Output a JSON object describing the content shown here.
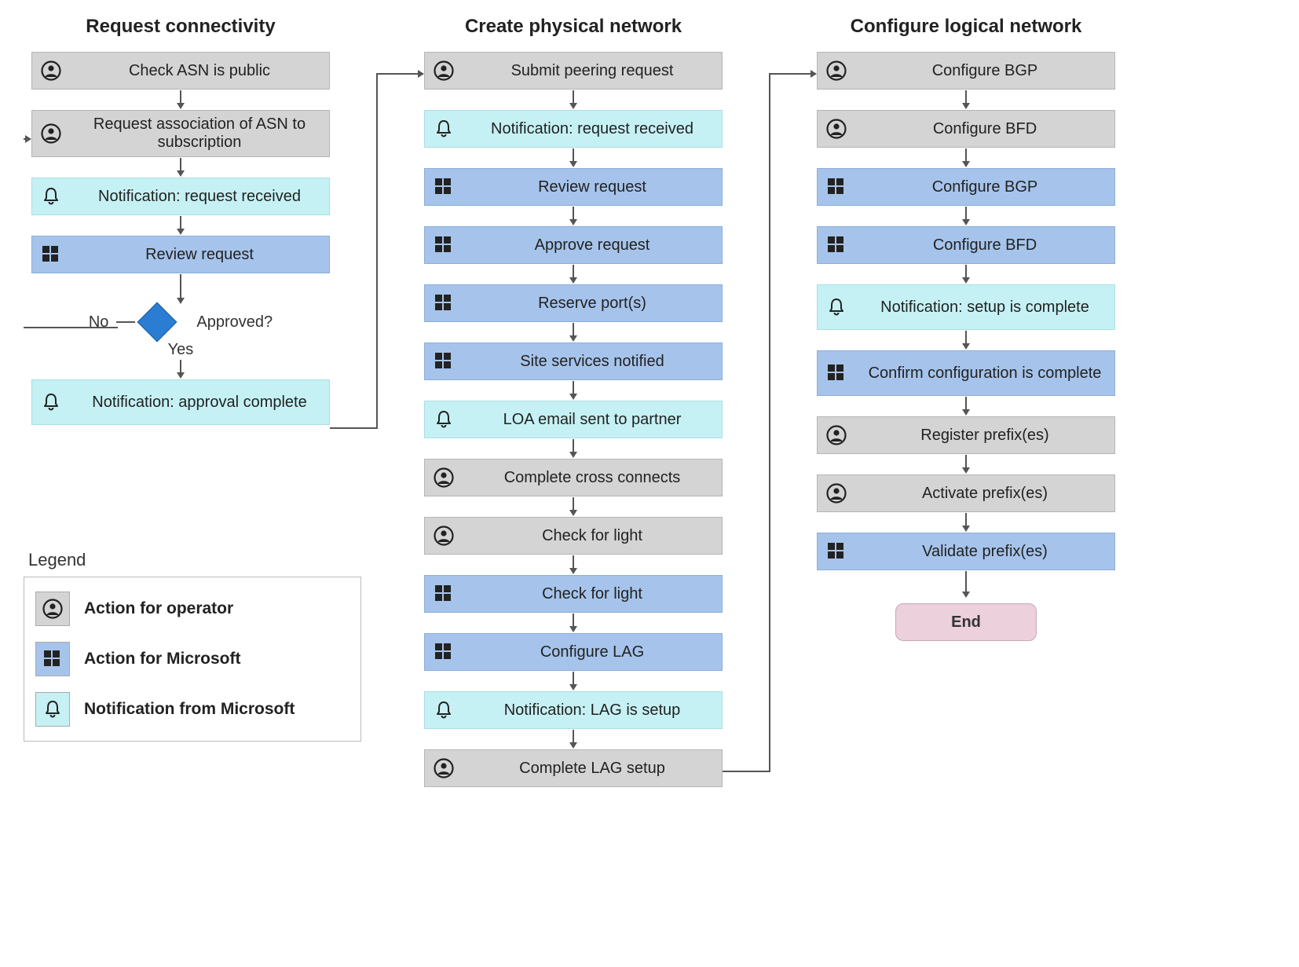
{
  "columns": {
    "c1": {
      "title": "Request connectivity",
      "steps": {
        "s0": "Check ASN is public",
        "s1": "Request association of ASN to subscription",
        "s2": "Notification: request received",
        "s3": "Review request",
        "s4_decision": "Approved?",
        "s4_no": "No",
        "s4_yes": "Yes",
        "s5": "Notification: approval complete"
      }
    },
    "c2": {
      "title": "Create physical network",
      "steps": {
        "s0": "Submit peering request",
        "s1": "Notification: request received",
        "s2": "Review request",
        "s3": "Approve request",
        "s4": "Reserve port(s)",
        "s5": "Site services notified",
        "s6": "LOA email sent to partner",
        "s7": "Complete cross connects",
        "s8": "Check for light",
        "s9": "Check for light",
        "s10": "Configure LAG",
        "s11": "Notification: LAG is setup",
        "s12": "Complete LAG setup"
      }
    },
    "c3": {
      "title": "Configure logical network",
      "steps": {
        "s0": "Configure BGP",
        "s1": "Configure BFD",
        "s2": "Configure BGP",
        "s3": "Configure BFD",
        "s4": "Notification: setup is complete",
        "s5": "Confirm configuration is complete",
        "s6": "Register prefix(es)",
        "s7": "Activate prefix(es)",
        "s8": "Validate prefix(es)",
        "end": "End"
      }
    }
  },
  "legend": {
    "title": "Legend",
    "items": {
      "operator": "Action for operator",
      "microsoft": "Action for Microsoft",
      "notification": "Notification from Microsoft"
    }
  },
  "icons": {
    "operator": "person-circle-icon",
    "microsoft": "windows-icon",
    "notification": "bell-icon"
  },
  "colors": {
    "operator_bg": "#d4d4d4",
    "microsoft_bg": "#a6c4eb",
    "notification_bg": "#c5f1f4",
    "decision_bg": "#2b7cd3",
    "end_bg": "#ecd0dc"
  }
}
